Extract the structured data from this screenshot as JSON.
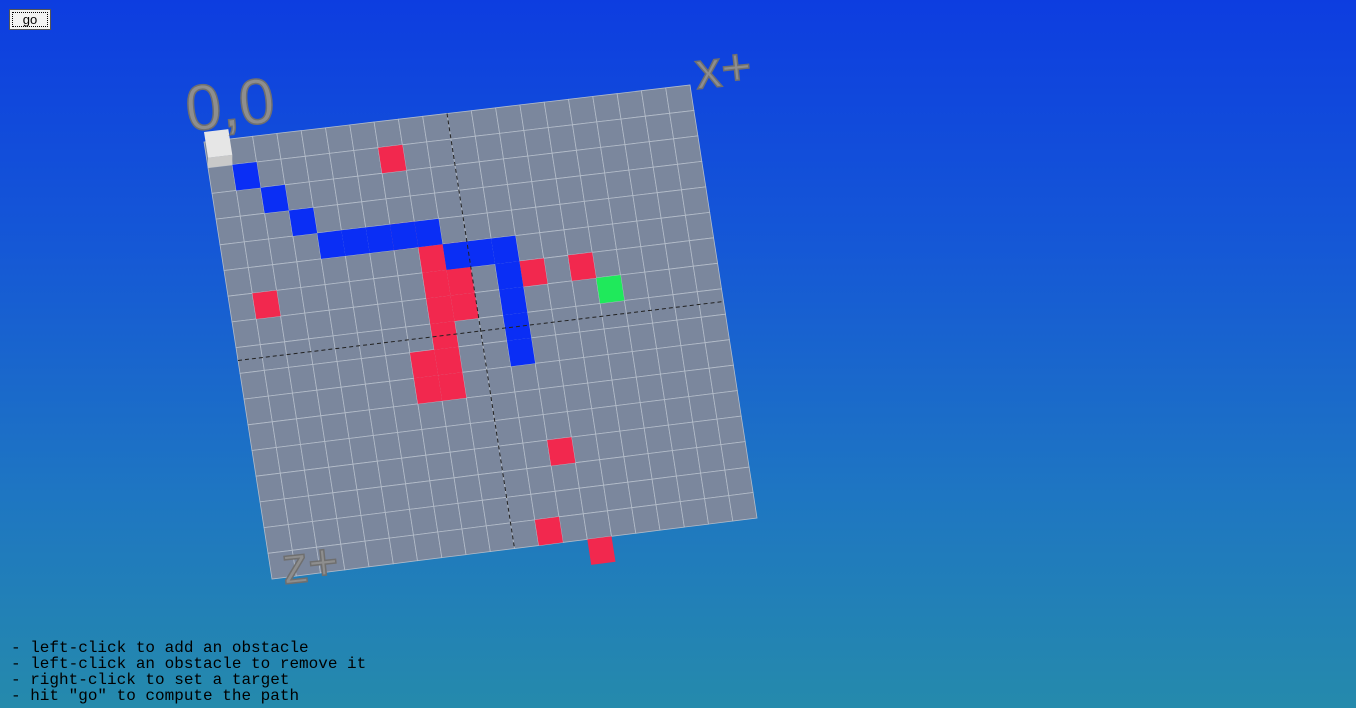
{
  "button": {
    "go_label": "go"
  },
  "labels": {
    "origin": "0,0",
    "x_axis": "x+",
    "z_axis": "z+"
  },
  "grid": {
    "cols": 20,
    "rows": 17,
    "start": [
      0,
      0
    ],
    "target": [
      15,
      7
    ],
    "obstacles": [
      [
        7,
        1
      ],
      [
        1,
        6
      ],
      [
        7,
        4
      ],
      [
        12,
        6
      ],
      [
        14,
        6
      ],
      [
        12,
        13
      ],
      [
        11,
        16
      ],
      [
        13,
        17
      ],
      [
        8,
        5
      ],
      [
        9,
        5
      ],
      [
        8,
        6
      ],
      [
        9,
        6
      ],
      [
        8,
        7
      ],
      [
        9,
        7
      ],
      [
        8,
        8
      ],
      [
        8,
        9
      ],
      [
        7,
        9
      ],
      [
        8,
        10
      ],
      [
        7,
        10
      ]
    ],
    "path": [
      [
        1,
        1
      ],
      [
        2,
        2
      ],
      [
        3,
        3
      ],
      [
        4,
        4
      ],
      [
        5,
        4
      ],
      [
        6,
        4
      ],
      [
        7,
        4
      ],
      [
        8,
        4
      ],
      [
        9,
        5
      ],
      [
        10,
        5
      ],
      [
        11,
        5
      ],
      [
        11,
        6
      ],
      [
        11,
        7
      ],
      [
        11,
        8
      ],
      [
        11,
        9
      ]
    ]
  },
  "colors": {
    "cell": "#7b879d",
    "gridline": "#b3bcc9",
    "obstacle": "#f2284e",
    "path": "#0a2ef5",
    "start": "#e6e6e6",
    "target": "#1fe95b",
    "label": "#8e8e8e"
  },
  "instructions": [
    "- left-click to add an obstacle",
    "- left-click an obstacle to remove it",
    "- right-click to set a target",
    "- hit \"go\" to compute the path"
  ]
}
